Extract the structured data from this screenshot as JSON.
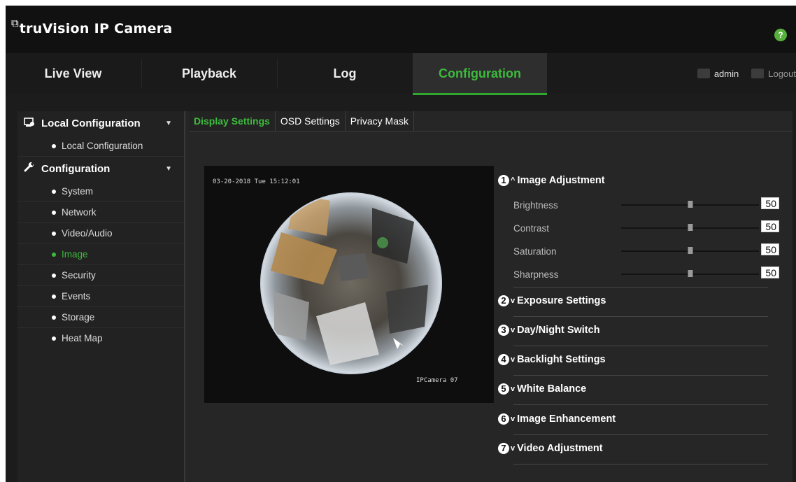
{
  "header": {
    "brand_mark": "⧉",
    "brand": "truVision IP Camera",
    "help_label": "?"
  },
  "nav": {
    "tabs": [
      {
        "label": "Live View",
        "active": false
      },
      {
        "label": "Playback",
        "active": false
      },
      {
        "label": "Log",
        "active": false
      },
      {
        "label": "Configuration",
        "active": true
      }
    ],
    "user": "admin",
    "logout": "Logout"
  },
  "sidebar": {
    "sections": [
      {
        "label": "Local Configuration",
        "icon": "local-config-icon",
        "items": [
          {
            "label": "Local Configuration",
            "active": false
          }
        ]
      },
      {
        "label": "Configuration",
        "icon": "wrench-icon",
        "items": [
          {
            "label": "System",
            "active": false
          },
          {
            "label": "Network",
            "active": false
          },
          {
            "label": "Video/Audio",
            "active": false
          },
          {
            "label": "Image",
            "active": true
          },
          {
            "label": "Security",
            "active": false
          },
          {
            "label": "Events",
            "active": false
          },
          {
            "label": "Storage",
            "active": false
          },
          {
            "label": "Heat Map",
            "active": false
          }
        ]
      }
    ]
  },
  "subtabs": [
    {
      "label": "Display Settings",
      "active": true
    },
    {
      "label": "OSD Settings",
      "active": false
    },
    {
      "label": "Privacy Mask",
      "active": false
    }
  ],
  "video": {
    "timestamp": "03-20-2018 Tue 15:12:01",
    "camera_name": "IPCamera 07"
  },
  "settings": {
    "image_adjustment": {
      "number": "1",
      "title": "Image Adjustment",
      "expanded": true,
      "sliders": [
        {
          "label": "Brightness",
          "value": "50",
          "fraction": 0.5
        },
        {
          "label": "Contrast",
          "value": "50",
          "fraction": 0.5
        },
        {
          "label": "Saturation",
          "value": "50",
          "fraction": 0.5
        },
        {
          "label": "Sharpness",
          "value": "50",
          "fraction": 0.5
        }
      ]
    },
    "sections": [
      {
        "number": "2",
        "title": "Exposure Settings"
      },
      {
        "number": "3",
        "title": "Day/Night Switch"
      },
      {
        "number": "4",
        "title": "Backlight Settings"
      },
      {
        "number": "5",
        "title": "White Balance"
      },
      {
        "number": "6",
        "title": "Image Enhancement"
      },
      {
        "number": "7",
        "title": "Video Adjustment"
      }
    ]
  },
  "colors": {
    "accent": "#3dbb3d",
    "background": "#1c1c1c",
    "header": "#111111"
  }
}
